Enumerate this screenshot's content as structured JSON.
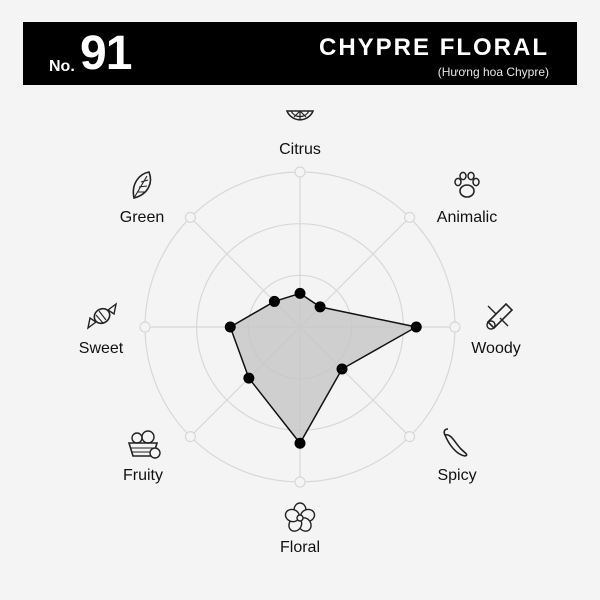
{
  "header": {
    "number_prefix": "No.",
    "number": "91",
    "title": "CHYPRE FLORAL",
    "subtitle": "(Hương hoa Chypre)"
  },
  "chart_data": {
    "type": "radar",
    "categories": [
      "Citrus",
      "Animalic",
      "Woody",
      "Spicy",
      "Floral",
      "Fruity",
      "Sweet",
      "Green"
    ],
    "icons": [
      "citrus-slice-icon",
      "paw-print-icon",
      "wood-log-icon",
      "chili-pepper-icon",
      "flower-icon",
      "fruit-basket-icon",
      "candy-icon",
      "leaf-icon"
    ],
    "values": [
      1.3,
      1.1,
      4.5,
      2.3,
      4.5,
      2.8,
      2.7,
      1.4
    ],
    "rmax": 6,
    "rings": [
      2,
      4,
      6
    ],
    "colors": {
      "fill": "#c8c8c8",
      "stroke": "#111111",
      "grid": "#d8d8d8",
      "marker": "#000000"
    }
  }
}
